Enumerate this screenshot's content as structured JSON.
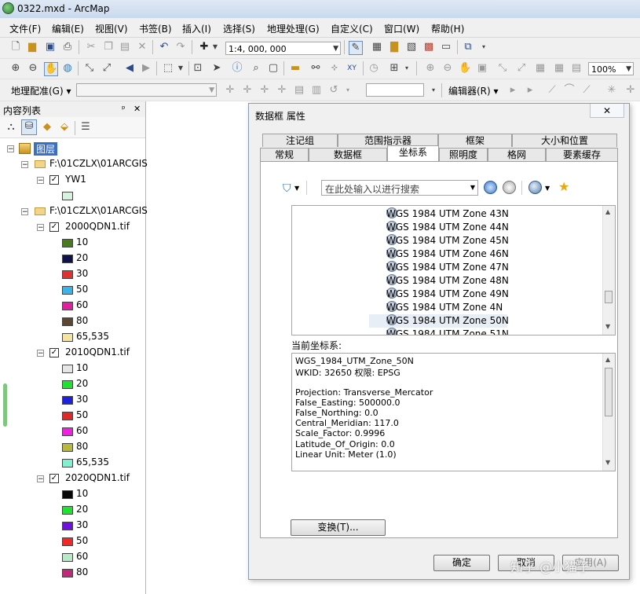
{
  "window": {
    "title": "0322.mxd - ArcMap"
  },
  "menu": [
    "文件(F)",
    "编辑(E)",
    "视图(V)",
    "书签(B)",
    "插入(I)",
    "选择(S)",
    "地理处理(G)",
    "自定义(C)",
    "窗口(W)",
    "帮助(H)"
  ],
  "toolbar": {
    "scale": "1:4, 000, 000",
    "zoom": "100%",
    "georef_label": "地理配准(G) ▾",
    "editor_label": "编辑器(R) ▾"
  },
  "toc": {
    "title": "内容列表",
    "pin": "ᵖ",
    "close": "✕",
    "root": "图层",
    "groups": [
      {
        "path": "F:\\01CZLX\\01ARCGIS",
        "layers": [
          {
            "name": "YW1",
            "legend": [
              {
                "label": "",
                "color": "#d9f2e0"
              }
            ]
          }
        ]
      },
      {
        "path": "F:\\01CZLX\\01ARCGIS",
        "layers": [
          {
            "name": "2000QDN1.tif",
            "legend": [
              {
                "label": "10",
                "color": "#4a7a1e"
              },
              {
                "label": "20",
                "color": "#10104a"
              },
              {
                "label": "30",
                "color": "#e03030"
              },
              {
                "label": "50",
                "color": "#3ab4e8"
              },
              {
                "label": "60",
                "color": "#e020a0"
              },
              {
                "label": "80",
                "color": "#5a4632"
              },
              {
                "label": "65,535",
                "color": "#f4e4a0"
              }
            ]
          },
          {
            "name": "2010QDN1.tif",
            "legend": [
              {
                "label": "10",
                "color": "#e6e6e6"
              },
              {
                "label": "20",
                "color": "#20e030"
              },
              {
                "label": "30",
                "color": "#2020e0"
              },
              {
                "label": "50",
                "color": "#e02828"
              },
              {
                "label": "60",
                "color": "#f020e0"
              },
              {
                "label": "80",
                "color": "#b8b83c"
              },
              {
                "label": "65,535",
                "color": "#80f0d0"
              }
            ]
          },
          {
            "name": "2020QDN1.tif",
            "legend": [
              {
                "label": "10",
                "color": "#080808"
              },
              {
                "label": "20",
                "color": "#20e030"
              },
              {
                "label": "30",
                "color": "#7010e0"
              },
              {
                "label": "50",
                "color": "#f02828"
              },
              {
                "label": "60",
                "color": "#b8e8c8"
              },
              {
                "label": "80",
                "color": "#c02878"
              }
            ]
          }
        ]
      }
    ]
  },
  "dialog": {
    "title": "数据框 属性",
    "close": "✕",
    "tabs_row1": [
      "注记组",
      "范围指示器",
      "框架",
      "大小和位置"
    ],
    "tabs_row2": [
      "常规",
      "数据框",
      "坐标系",
      "照明度",
      "格网",
      "要素缓存"
    ],
    "selected_tab": "坐标系",
    "search_placeholder": "在此处输入以进行搜索",
    "cs_list": [
      "WGS 1984 UTM Zone 43N",
      "WGS 1984 UTM Zone 44N",
      "WGS 1984 UTM Zone 45N",
      "WGS 1984 UTM Zone 46N",
      "WGS 1984 UTM Zone 47N",
      "WGS 1984 UTM Zone 48N",
      "WGS 1984 UTM Zone 49N",
      "WGS 1984 UTM Zone 4N",
      "WGS 1984 UTM Zone 50N",
      "WGS 1984 UTM Zone 51N"
    ],
    "selected_cs": "WGS 1984 UTM Zone 50N",
    "current_label": "当前坐标系:",
    "current_info": [
      "WGS_1984_UTM_Zone_50N",
      "WKID: 32650 权限: EPSG",
      "",
      "Projection: Transverse_Mercator",
      "False_Easting: 500000.0",
      "False_Northing: 0.0",
      "Central_Meridian: 117.0",
      "Scale_Factor: 0.9996",
      "Latitude_Of_Origin: 0.0",
      "Linear Unit: Meter (1.0)"
    ],
    "transform_button": "变换(T)...",
    "ok_button": "确定",
    "cancel_button": "取消",
    "apply_button": "应用(A)"
  },
  "watermark": "知乎 @小猫子"
}
